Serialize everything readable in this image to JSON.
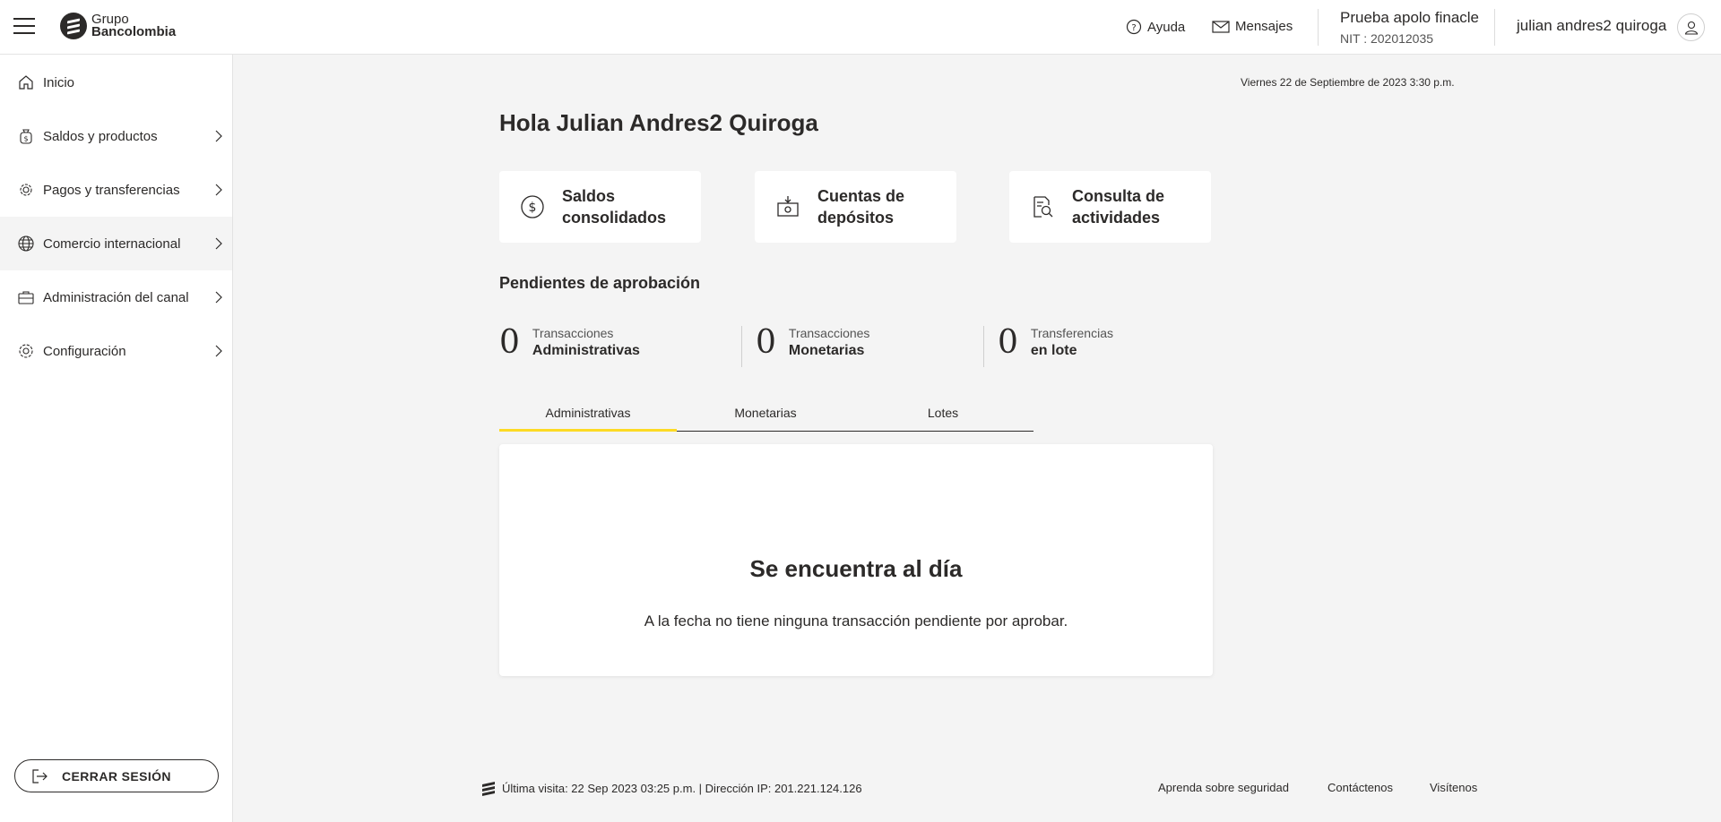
{
  "header": {
    "logo_line1": "Grupo",
    "logo_line2": "Bancolombia",
    "help_label": "Ayuda",
    "messages_label": "Mensajes",
    "company_name": "Prueba apolo finacle",
    "company_nit": "NIT : 202012035",
    "user_name": "julian andres2 quiroga"
  },
  "sidebar": {
    "items": [
      {
        "label": "Inicio",
        "icon": "home-icon"
      },
      {
        "label": "Saldos y productos",
        "icon": "money-bag-icon"
      },
      {
        "label": "Pagos y transferencias",
        "icon": "payments-gear-icon"
      },
      {
        "label": "Comercio internacional",
        "icon": "globe-icon"
      },
      {
        "label": "Administración del canal",
        "icon": "briefcase-icon"
      },
      {
        "label": "Configuración",
        "icon": "gear-icon"
      }
    ],
    "logout_label": "CERRAR SESIÓN"
  },
  "main": {
    "date": "Viernes 22 de Septiembre de 2023 3:30 p.m.",
    "greeting": "Hola Julian Andres2 Quiroga",
    "cards": [
      {
        "label": "Saldos consolidados",
        "icon": "dollar-circle-icon"
      },
      {
        "label": "Cuentas de depósitos",
        "icon": "deposit-icon"
      },
      {
        "label": "Consulta de actividades",
        "icon": "document-search-icon"
      }
    ],
    "pending_title": "Pendientes de aprobación",
    "counters": [
      {
        "value": "0",
        "line1": "Transacciones",
        "line2": "Administrativas"
      },
      {
        "value": "0",
        "line1": "Transacciones",
        "line2": "Monetarias"
      },
      {
        "value": "0",
        "line1": "Transferencias",
        "line2": "en lote"
      }
    ],
    "tabs": [
      "Administrativas",
      "Monetarias",
      "Lotes"
    ],
    "active_tab": "Administrativas",
    "panel_title": "Se encuentra al día",
    "panel_message": "A la fecha no tiene ninguna transacción pendiente por aprobar."
  },
  "footer": {
    "last_visit": "Última visita: 22 Sep 2023 03:25 p.m. | Dirección IP: 201.221.124.126",
    "links": [
      "Aprenda sobre seguridad",
      "Contáctenos",
      "Visítenos"
    ]
  },
  "colors": {
    "accent": "#fdda24",
    "text": "#2c2a29",
    "background": "#f4f4f4"
  }
}
